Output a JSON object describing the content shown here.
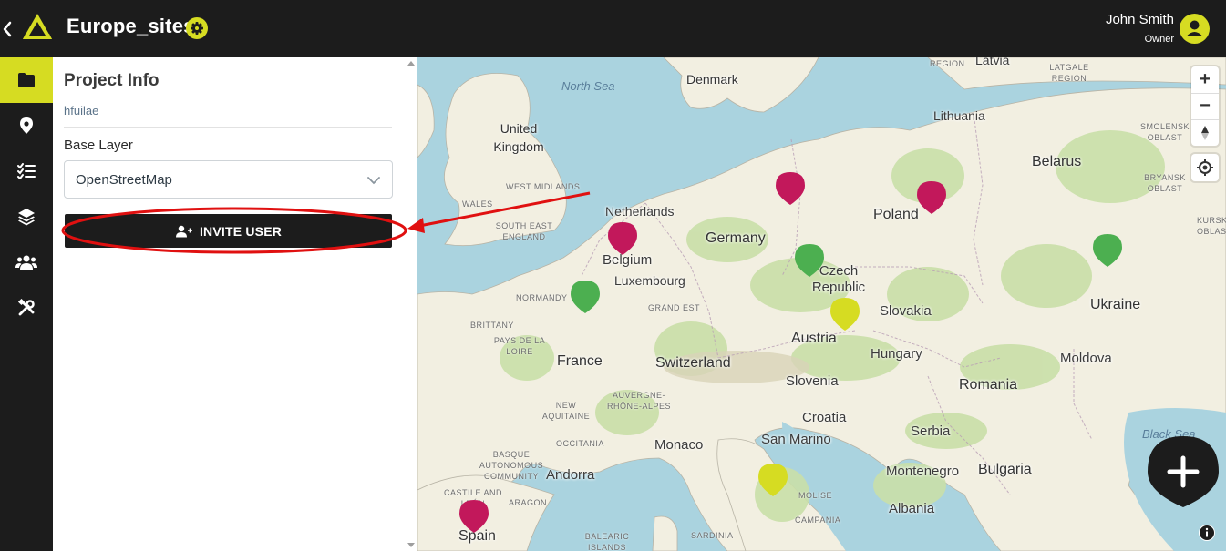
{
  "header": {
    "back_icon": "chevron-left-icon",
    "project_title": "Europe_sites",
    "settings_icon": "gear-icon",
    "user_name": "John Smith",
    "user_role": "Owner"
  },
  "nav": {
    "items": [
      {
        "icon": "folder-icon",
        "active": true
      },
      {
        "icon": "map-pin-icon",
        "active": false
      },
      {
        "icon": "checklist-icon",
        "active": false
      },
      {
        "icon": "layers-icon",
        "active": false
      },
      {
        "icon": "users-icon",
        "active": false
      },
      {
        "icon": "tools-icon",
        "active": false
      }
    ]
  },
  "panel": {
    "title": "Project Info",
    "subtitle": "hfuilae",
    "base_layer_label": "Base Layer",
    "base_layer_value": "OpenStreetMap",
    "invite_label": "INVITE USER"
  },
  "map": {
    "seas": [
      "North Sea",
      "Black Sea"
    ],
    "countries": [
      "Denmark",
      "United Kingdom",
      "Netherlands",
      "Belgium",
      "Luxembourg",
      "Germany",
      "Poland",
      "Belarus",
      "Lithuania",
      "Latvia",
      "Czech Republic",
      "Slovakia",
      "Ukraine",
      "Austria",
      "Hungary",
      "Moldova",
      "France",
      "Switzerland",
      "Slovenia",
      "Romania",
      "Croatia",
      "Serbia",
      "Monaco",
      "San Marino",
      "Andorra",
      "Montenegro",
      "Bulgaria",
      "Albania",
      "Spain"
    ],
    "regions": [
      "WEST MIDLANDS",
      "WALES",
      "SOUTH EAST ENGLAND",
      "NORMANDY",
      "GRAND EST",
      "BRITTANY",
      "PAYS DE LA LOIRE",
      "NEW AQUITAINE",
      "AUVERGNE-RHÔNE-ALPES",
      "OCCITANIA",
      "BASQUE AUTONOMOUS COMMUNITY",
      "CASTILE AND LEÓN",
      "ARAGON",
      "BALEARIC ISLANDS",
      "SARDINIA",
      "MOLISE",
      "CAMPANIA",
      "REGION",
      "LATGALE REGION",
      "SMOLENSK OBLAST",
      "BRYANSK OBLAST",
      "KURSK OBLAST"
    ],
    "markers": [
      {
        "color": "#c2185b",
        "location": "Netherlands"
      },
      {
        "color": "#c2185b",
        "location": "Germany"
      },
      {
        "color": "#c2185b",
        "location": "Poland"
      },
      {
        "color": "#4caf50",
        "location": "France"
      },
      {
        "color": "#4caf50",
        "location": "Czech Republic"
      },
      {
        "color": "#4caf50",
        "location": "Ukraine"
      },
      {
        "color": "#d6dc22",
        "location": "Austria"
      },
      {
        "color": "#d6dc22",
        "location": "Italy"
      },
      {
        "color": "#c2185b",
        "location": "Spain"
      }
    ],
    "zoom_in": "+",
    "zoom_out": "−"
  },
  "colors": {
    "accent": "#d6dc22",
    "dark": "#1c1c1c",
    "water": "#aad3df",
    "land": "#f2efe1",
    "forest": "#c9dfa8"
  }
}
